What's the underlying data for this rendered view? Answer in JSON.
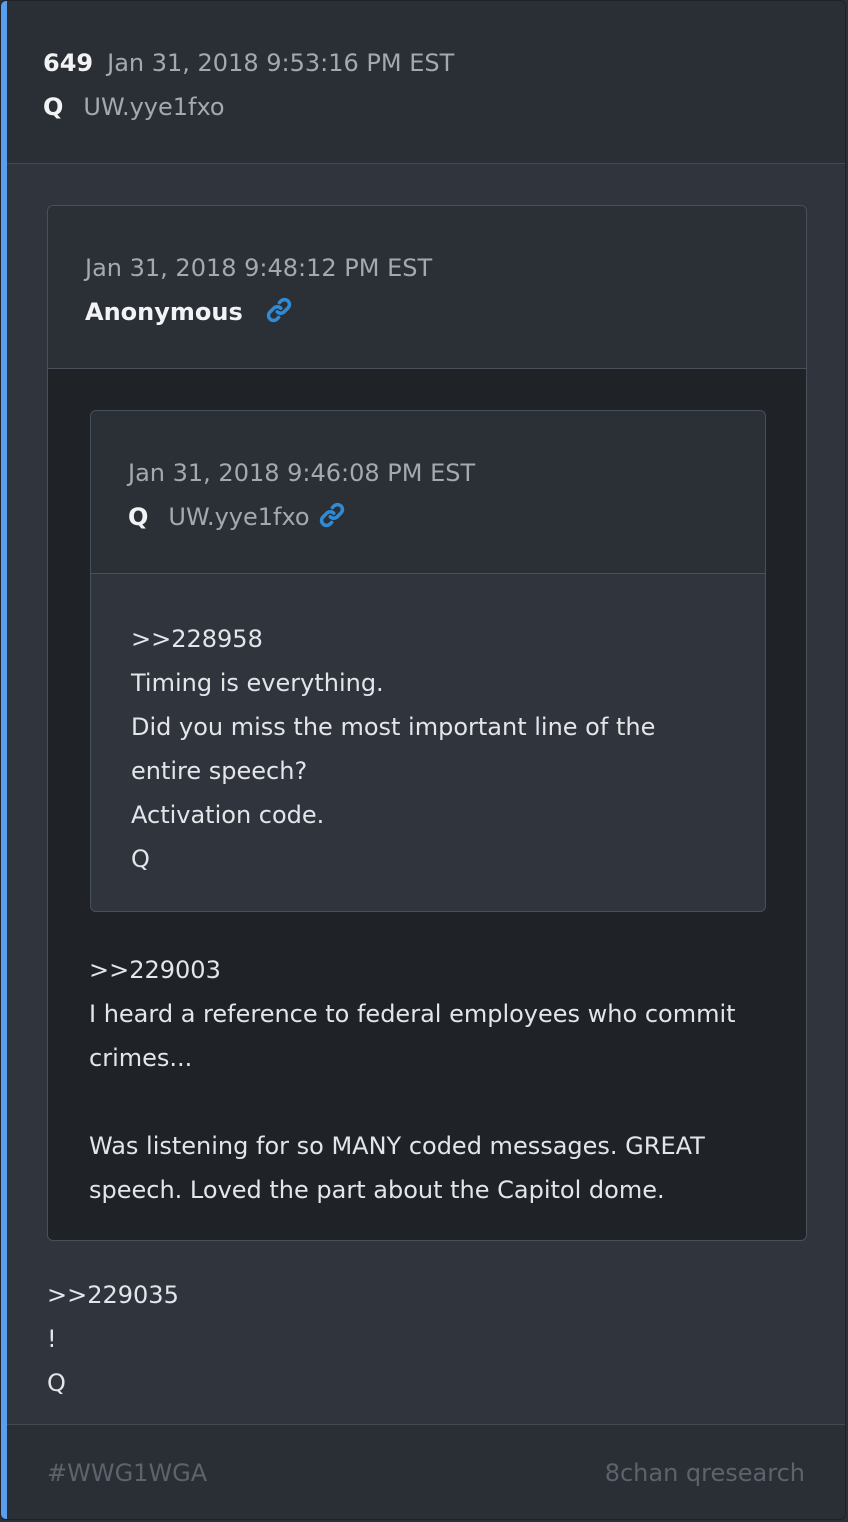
{
  "colors": {
    "accent": "#5b9ef0",
    "link_icon": "#2f8bd6"
  },
  "post": {
    "number": "649",
    "date": "Jan 31, 2018 9:53:16 PM EST",
    "name": "Q",
    "tripcode": "UW.yye1fxo",
    "body_lines": [
      ">>229035",
      "!",
      "Q"
    ]
  },
  "quote1": {
    "date": "Jan 31, 2018 9:48:12 PM EST",
    "name": "Anonymous",
    "link_icon": "link-icon",
    "body_lines": [
      ">>229003",
      "I heard a reference to federal employees who commit",
      "crimes...",
      "",
      "Was listening for so MANY coded messages.  GREAT",
      "speech.  Loved the part about the Capitol dome."
    ]
  },
  "quote2": {
    "date": "Jan 31, 2018 9:46:08 PM EST",
    "name": "Q",
    "tripcode": "UW.yye1fxo",
    "link_icon": "link-icon",
    "body_lines": [
      ">>228958",
      "Timing is everything.",
      "Did you miss the most important line of the",
      "entire speech?",
      "Activation code.",
      "Q"
    ]
  },
  "footer": {
    "hashtag": "#WWG1WGA",
    "source": "8chan qresearch"
  }
}
